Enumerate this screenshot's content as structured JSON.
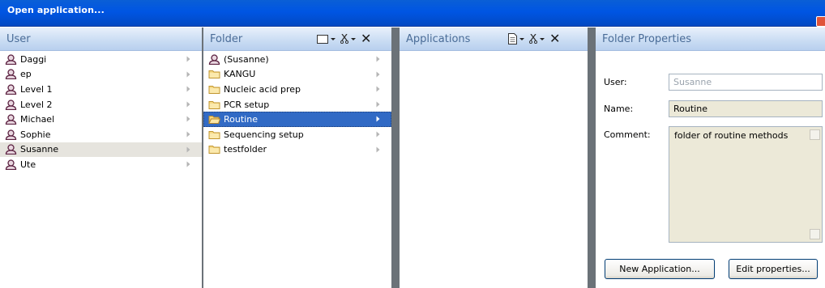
{
  "window": {
    "title": "Open application..."
  },
  "user_column": {
    "header": "User",
    "items": [
      {
        "label": "Daggi",
        "icon": "user-icon"
      },
      {
        "label": "ep",
        "icon": "user-icon"
      },
      {
        "label": "Level 1",
        "icon": "user-icon"
      },
      {
        "label": "Level 2",
        "icon": "user-icon"
      },
      {
        "label": "Michael",
        "icon": "user-icon"
      },
      {
        "label": "Sophie",
        "icon": "user-icon"
      },
      {
        "label": "Susanne",
        "icon": "user-icon",
        "state": "highlighted"
      },
      {
        "label": "Ute",
        "icon": "user-icon"
      }
    ]
  },
  "folder_column": {
    "header": "Folder",
    "toolbar": [
      "new-folder-icon",
      "cut-icon",
      "delete-icon"
    ],
    "items": [
      {
        "label": "(Susanne)",
        "icon": "user-icon"
      },
      {
        "label": "KANGU",
        "icon": "folder-icon"
      },
      {
        "label": "Nucleic acid prep",
        "icon": "folder-icon"
      },
      {
        "label": "PCR setup",
        "icon": "folder-icon"
      },
      {
        "label": "Routine",
        "icon": "open-folder-icon",
        "state": "selected"
      },
      {
        "label": "Sequencing setup",
        "icon": "folder-icon"
      },
      {
        "label": "testfolder",
        "icon": "folder-icon"
      }
    ]
  },
  "applications_column": {
    "header": "Applications",
    "toolbar": [
      "new-document-icon",
      "cut-icon",
      "delete-icon"
    ]
  },
  "properties": {
    "header": "Folder Properties",
    "user_label": "User:",
    "user_value": "Susanne",
    "name_label": "Name:",
    "name_value": "Routine",
    "comment_label": "Comment:",
    "comment_value": "folder of routine methods",
    "new_app_button": "New Application...",
    "edit_props_button": "Edit properties..."
  },
  "colors": {
    "titlebar": "#0055e3",
    "selection": "#316ac5",
    "header_text": "#4a6c97"
  }
}
